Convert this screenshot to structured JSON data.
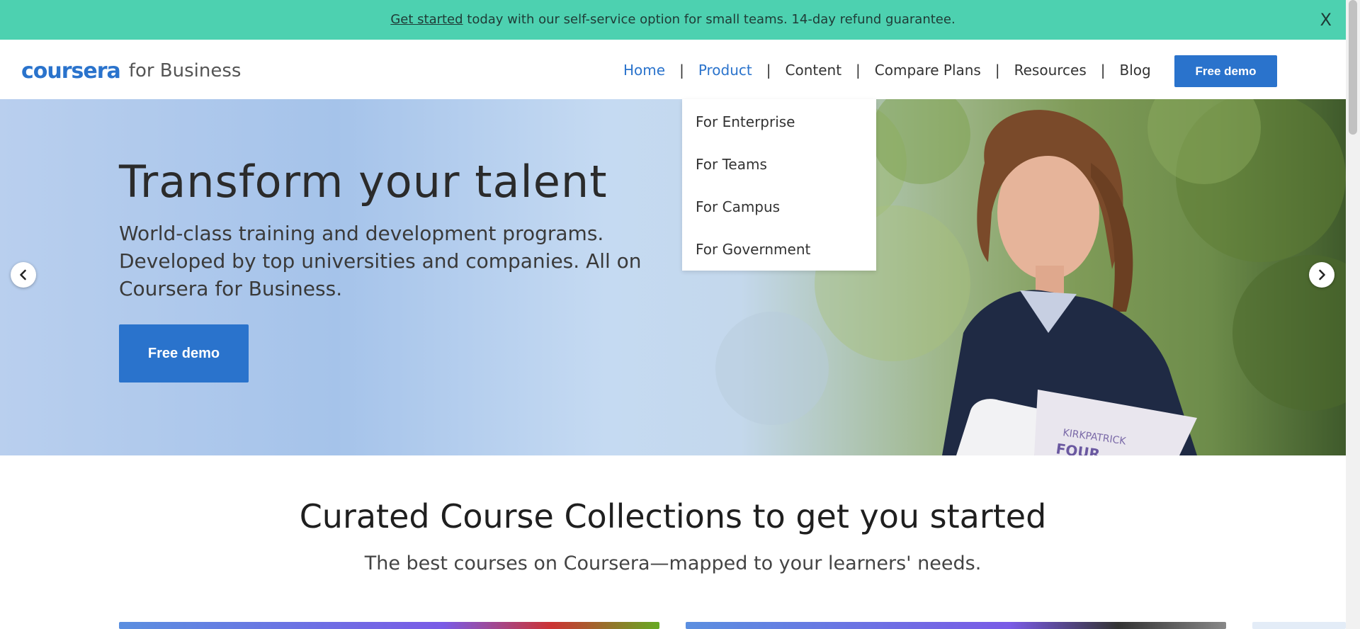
{
  "promo": {
    "link_text": "Get started",
    "text": " today with our self-service option for small teams. 14-day refund guarantee.",
    "close": "X"
  },
  "brand": {
    "name": "coursera",
    "suffix": "for Business"
  },
  "nav": {
    "items": [
      {
        "label": "Home"
      },
      {
        "label": "Product"
      },
      {
        "label": "Content"
      },
      {
        "label": "Compare Plans"
      },
      {
        "label": "Resources"
      },
      {
        "label": "Blog"
      }
    ],
    "separator": "|",
    "cta": "Free demo"
  },
  "product_menu": {
    "items": [
      "For Enterprise",
      "For Teams",
      "For Campus",
      "For Government"
    ]
  },
  "hero": {
    "title": "Transform your talent",
    "subtitle": "World-class training and development programs. Developed by top universities and companies. All on Coursera for Business.",
    "cta": "Free demo"
  },
  "collections": {
    "title": "Curated Course Collections to get you started",
    "subtitle": "The best courses on Coursera—mapped to your learners' needs."
  },
  "colors": {
    "accent": "#2a73cc",
    "promo_bg": "#4dd1b0"
  }
}
